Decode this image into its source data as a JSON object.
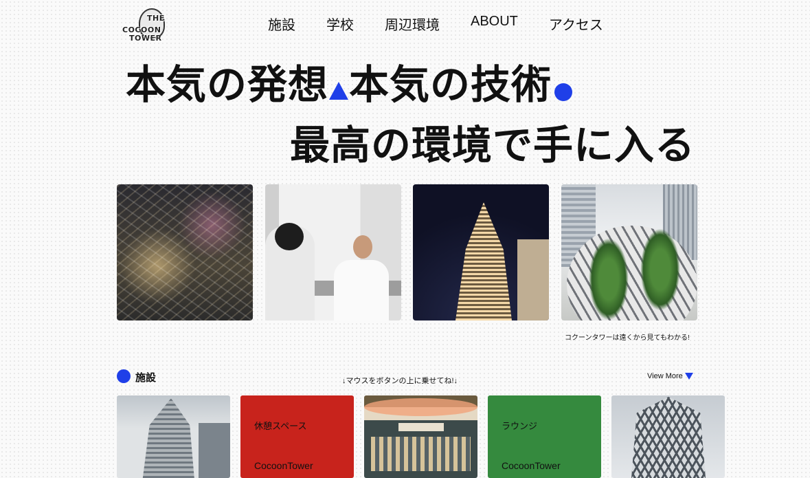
{
  "brand": {
    "logo_line1": "THE",
    "logo_line2": "COCOON",
    "logo_line3": "TOWER"
  },
  "nav": {
    "items": [
      "施設",
      "学校",
      "周辺環境",
      "ABOUT",
      "アクセス"
    ]
  },
  "hero": {
    "line1a": "本気の発想",
    "line1b": "本気の技術",
    "line2": "最高の環境で手に入る"
  },
  "accent_color": "#1f3fe8",
  "photo_caption": "コクーンタワーは遠くから見てもわかる!",
  "facilities": {
    "title": "施設",
    "hint": "↓マウスをボタンの上に乗せてね!↓",
    "view_more": "View More",
    "cards": [
      {
        "type": "photo"
      },
      {
        "type": "text",
        "color": "#c8231c",
        "label": "休憩スペース",
        "sub": "CocoonTower"
      },
      {
        "type": "photo"
      },
      {
        "type": "text",
        "color": "#358a3e",
        "label": "ラウンジ",
        "sub": "CocoonTower"
      },
      {
        "type": "photo"
      }
    ]
  }
}
